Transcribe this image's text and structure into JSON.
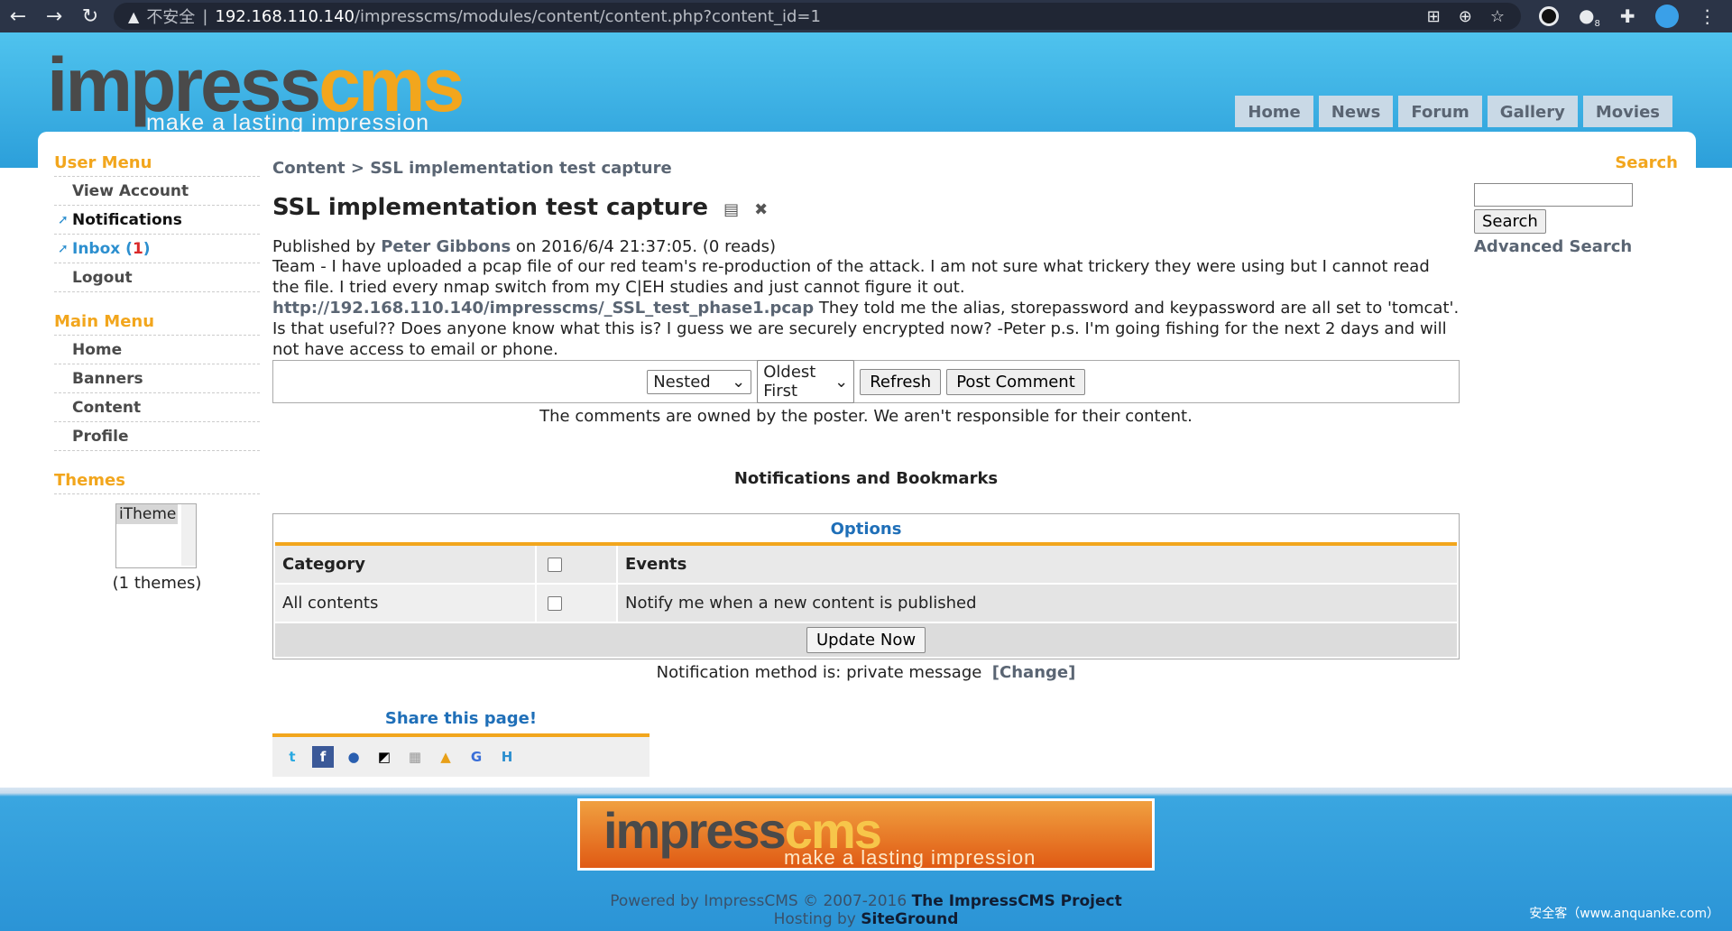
{
  "browser": {
    "insecure_label": "不安全",
    "url_host": "192.168.110.140",
    "url_path": "/impresscms/modules/content/content.php?content_id=1",
    "ext_badge": "8"
  },
  "logo": {
    "impress": "impress",
    "cms": "cms",
    "tagline": "make a lasting impression"
  },
  "topnav": [
    "Home",
    "News",
    "Forum",
    "Gallery",
    "Movies"
  ],
  "user_menu": {
    "title": "User Menu",
    "items": [
      "View Account",
      "Notifications",
      "Inbox",
      "Logout"
    ],
    "inbox_open": " (",
    "inbox_count": "1",
    "inbox_close": ")"
  },
  "main_menu": {
    "title": "Main Menu",
    "items": [
      "Home",
      "Banners",
      "Content",
      "Profile"
    ]
  },
  "themes": {
    "title": "Themes",
    "selected": "iTheme",
    "count_text": "(1 themes)"
  },
  "breadcrumb": {
    "root": "Content",
    "sep": " > ",
    "current": "SSL implementation test capture"
  },
  "article": {
    "title": "SSL implementation test capture",
    "published_prefix": "Published by ",
    "author": "Peter Gibbons",
    "published_suffix": " on 2016/6/4 21:37:05. (0 reads)",
    "body_1": "Team - I have uploaded a pcap file of our red team's re-production of the attack. I am not sure what trickery they were using but I cannot read the file. I tried every nmap switch from my C|EH studies and just cannot figure it out.",
    "link": "http://192.168.110.140/impresscms/_SSL_test_phase1.pcap",
    "body_2": " They told me the alias, storepassword and keypassword are all set to 'tomcat'. Is that useful?? Does anyone know what this is? I guess we are securely encrypted now? -Peter p.s. I'm going fishing for the next 2 days and will not have access to email or phone."
  },
  "comments": {
    "mode": "Nested",
    "order": "Oldest First",
    "refresh": "Refresh",
    "post": "Post Comment",
    "disclaimer": "The comments are owned by the poster. We aren't responsible for their content."
  },
  "notifications": {
    "title": "Notifications and Bookmarks",
    "options": "Options",
    "col_category": "Category",
    "col_events": "Events",
    "row_category": "All contents",
    "row_event": "Notify me when a new content is published",
    "update": "Update Now",
    "method_text": "Notification method is: private message",
    "change": "[Change]"
  },
  "share": {
    "title": "Share this page!"
  },
  "search": {
    "title": "Search",
    "button": "Search",
    "advanced": "Advanced Search"
  },
  "footer": {
    "powered_prefix": "Powered by ImpressCMS © 2007-2016 ",
    "project": "The ImpressCMS Project",
    "hosting_prefix": "Hosting by ",
    "host": "SiteGround",
    "watermark": "安全客（www.anquanke.com）"
  }
}
